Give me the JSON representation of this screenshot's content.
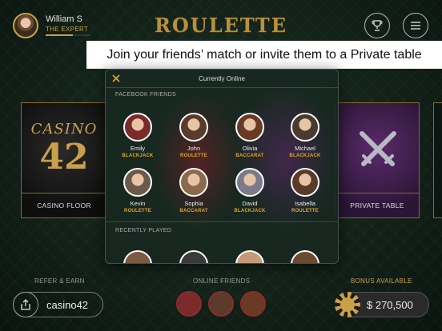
{
  "header": {
    "user_name": "William S",
    "user_level": "THE EXPERT",
    "xp_progress": 0.6,
    "logo": "ROULETTE",
    "trophy_icon": "trophy-icon",
    "menu_icon": "hamburger-menu-icon"
  },
  "banner": {
    "text": "Join your friends’ match or invite them to a Private table"
  },
  "cards": {
    "casino_word": "CASINO",
    "casino_number": "42",
    "casino_label": "CASINO FLOOR",
    "private_label": "PRIVATE TABLE"
  },
  "modal": {
    "title": "Currently Online",
    "close_icon": "close-icon",
    "facebook_section": "FACEBOOK FRIENDS",
    "recent_section": "RECENTLY PLAYED",
    "friends": [
      {
        "name": "Emily",
        "game": "BLACKJACK",
        "color": "#7a2a2a"
      },
      {
        "name": "John",
        "game": "ROULETTE",
        "color": "#5a3a2a"
      },
      {
        "name": "Olivia",
        "game": "BACCARAT",
        "color": "#6a3a22"
      },
      {
        "name": "Michael",
        "game": "BLACKJACK",
        "color": "#4a3a30"
      },
      {
        "name": "Kevin",
        "game": "ROULETTE",
        "color": "#6b5a4a"
      },
      {
        "name": "Sophia",
        "game": "BACCARAT",
        "color": "#8a6a4a"
      },
      {
        "name": "David",
        "game": "BLACKJACK",
        "color": "#7a7a8a"
      },
      {
        "name": "Isabella",
        "game": "ROULETTE",
        "color": "#5a3a28"
      }
    ]
  },
  "bottom": {
    "refer_label": "REFER & EARN",
    "refer_code": "casino42",
    "online_label": "ONLINE FRIENDS",
    "bonus_label": "BONUS AVAILABLE",
    "bonus_amount": "$ 270,500"
  },
  "colors": {
    "gold": "#c9a14a",
    "game_label": "#e4a62a",
    "background": "#122219"
  }
}
